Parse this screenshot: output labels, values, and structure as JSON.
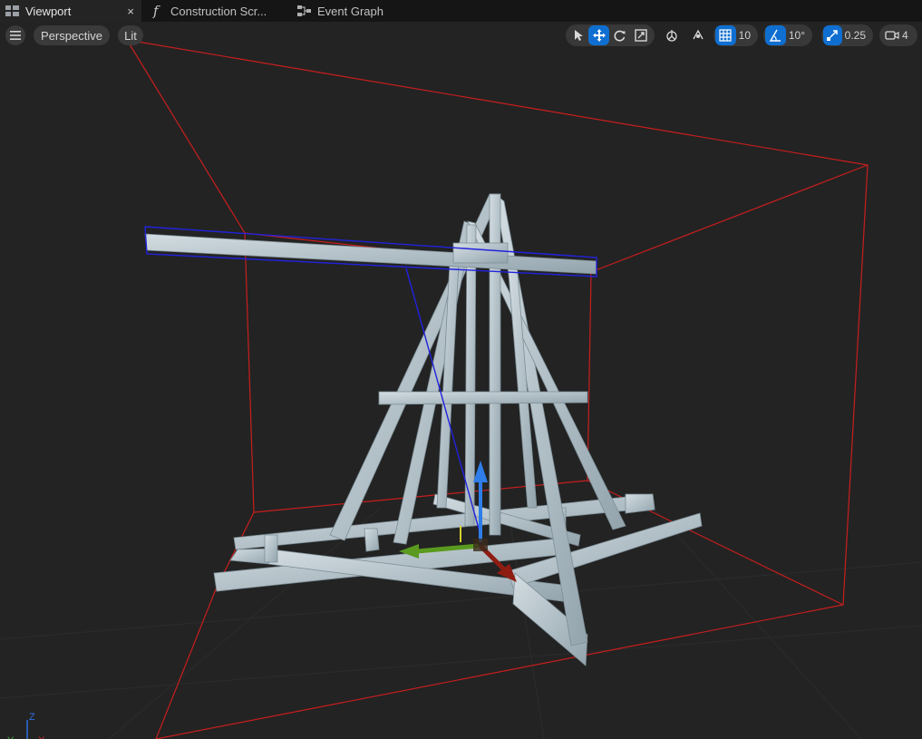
{
  "tabs": [
    {
      "label": "Viewport",
      "active": true,
      "icon": "viewport-icon",
      "close": "×"
    },
    {
      "label": "Construction Scr...",
      "active": false,
      "icon": "function-icon"
    },
    {
      "label": "Event Graph",
      "active": false,
      "icon": "graph-icon"
    }
  ],
  "viewport_toolbar": {
    "menu_icon": "hamburger-icon",
    "view_mode": "Perspective",
    "lighting": "Lit",
    "grid_snap": "10",
    "rotation_snap": "10°",
    "scale_snap": "0.25",
    "camera_speed": "4"
  },
  "axis_indicator": {
    "x": "X",
    "y": "Y",
    "z": "Z"
  },
  "colors": {
    "accent": "#0f6fd1",
    "bounds": "#c81e1e",
    "selection": "#2222dd",
    "mesh": "#b9c6cc"
  }
}
